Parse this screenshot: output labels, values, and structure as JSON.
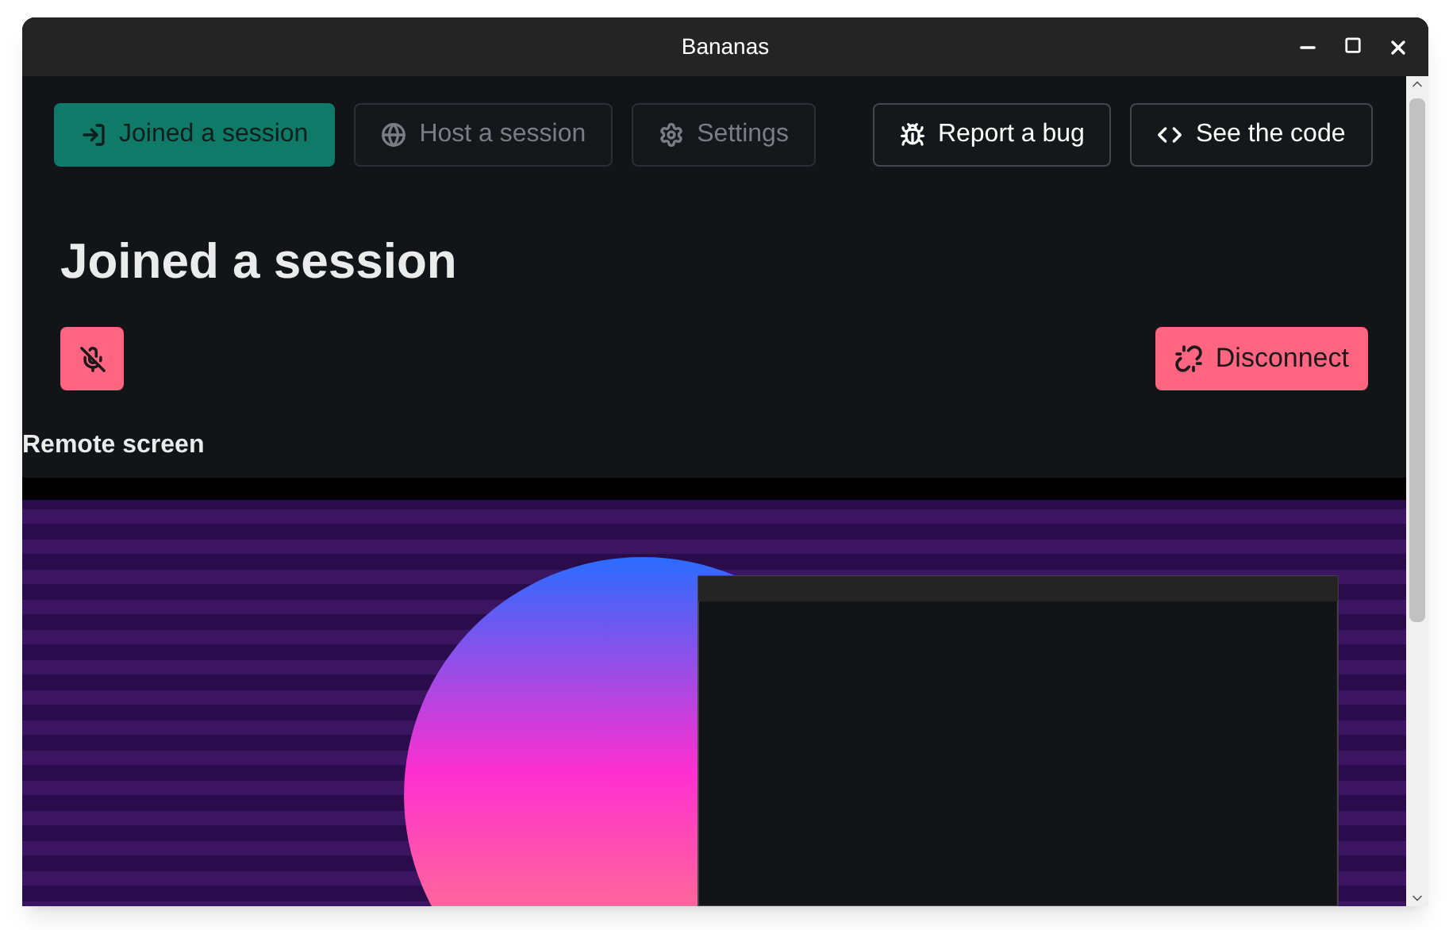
{
  "window": {
    "title": "Bananas"
  },
  "nav": [
    {
      "kind": "tab",
      "label": "Joined a session",
      "selected": true,
      "disabled": false
    },
    {
      "kind": "tab",
      "label": "Host a session",
      "selected": false,
      "disabled": true
    },
    {
      "kind": "tab",
      "label": "Settings",
      "selected": false,
      "disabled": true
    },
    {
      "kind": "link",
      "label": "Report a bug"
    },
    {
      "kind": "link",
      "label": "See the code"
    }
  ],
  "heading": "Joined a session",
  "mic": {
    "muted": true
  },
  "disconnect": {
    "label": "Disconnect"
  },
  "remote_screen": {
    "label": "Remote screen"
  }
}
